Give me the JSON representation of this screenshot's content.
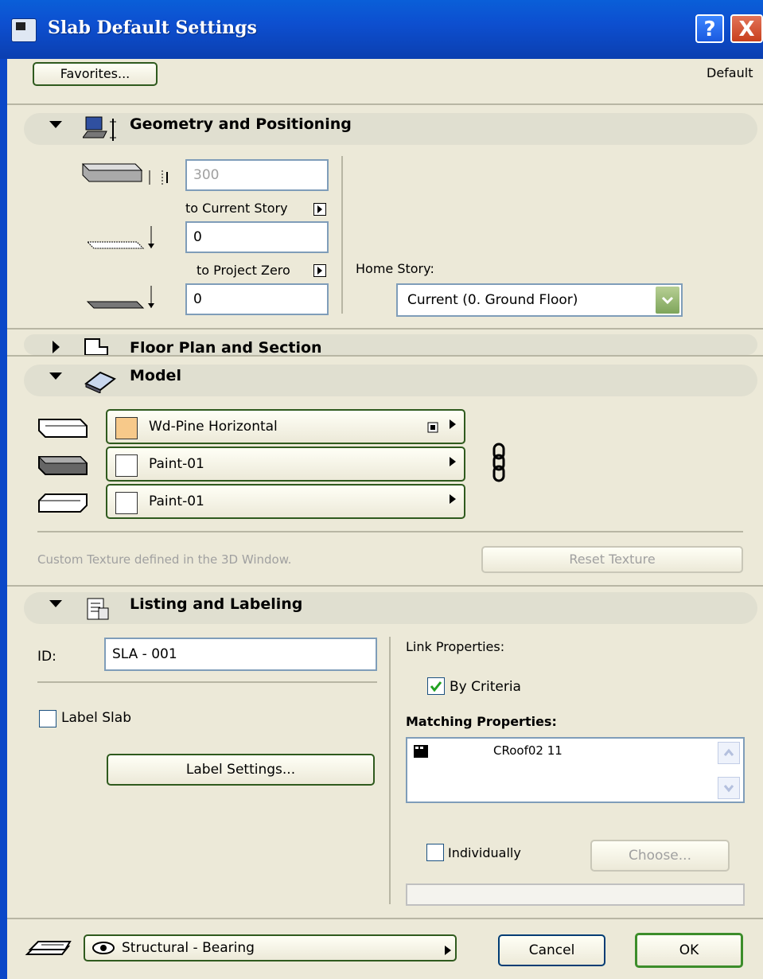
{
  "window": {
    "title": "Slab Default Settings",
    "help": "?",
    "close": "X"
  },
  "top": {
    "favorites_label": "Favorites...",
    "default_label": "Default"
  },
  "geometry": {
    "title": "Geometry and Positioning",
    "thickness_value": "300",
    "to_current_story_label": "to Current Story",
    "current_story_value": "0",
    "to_project_zero_label": "to Project Zero",
    "project_zero_value": "0",
    "home_story_label": "Home Story:",
    "home_story_value": "Current (0. Ground Floor)"
  },
  "floorplan": {
    "title": "Floor Plan and Section"
  },
  "model": {
    "title": "Model",
    "materials": [
      {
        "name": "Wd-Pine Horizontal",
        "swatch": "#f7c98a"
      },
      {
        "name": "Paint-01",
        "swatch": "#ffffff"
      },
      {
        "name": "Paint-01",
        "swatch": "#ffffff"
      }
    ],
    "custom_texture_note": "Custom Texture defined in the 3D Window.",
    "reset_texture_label": "Reset Texture"
  },
  "listing": {
    "title": "Listing and Labeling",
    "id_label": "ID:",
    "id_value": "SLA - 001",
    "label_slab": "Label Slab",
    "label_settings": "Label Settings...",
    "link_properties_label": "Link Properties:",
    "by_criteria": "By Criteria",
    "matching_properties_label": "Matching Properties:",
    "matching_item": "CRoof02 11",
    "individually": "Individually",
    "choose_label": "Choose..."
  },
  "footer": {
    "layer_value": "Structural - Bearing",
    "cancel_label": "Cancel",
    "ok_label": "OK"
  },
  "colors": {
    "titlebar": "#0b4fd0",
    "dialog_bg": "#ece9d8",
    "check_green": "#21a121"
  }
}
